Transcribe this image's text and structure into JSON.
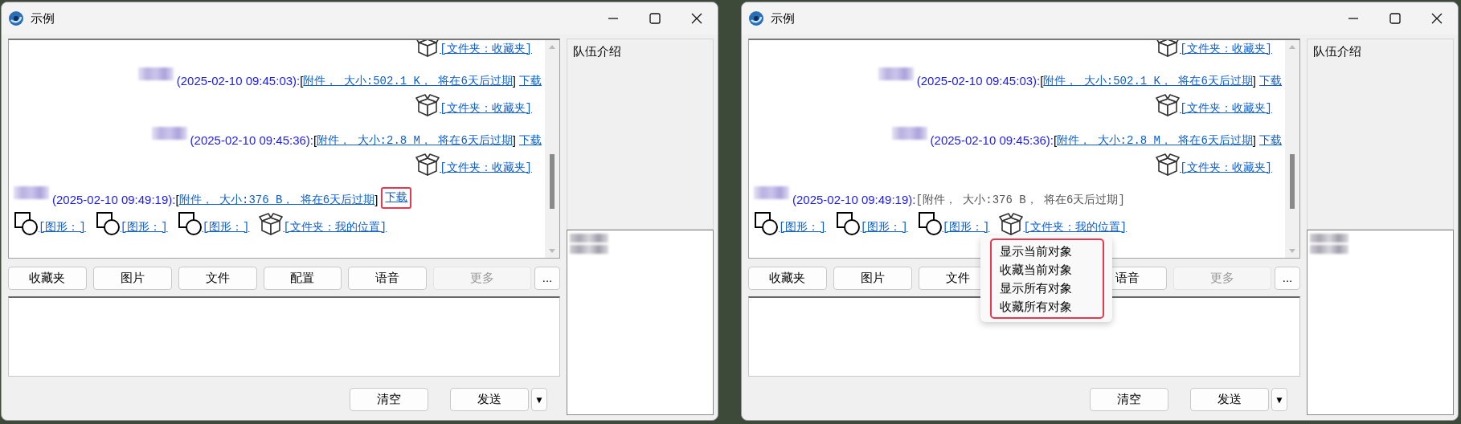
{
  "windows": [
    {
      "title": "示例",
      "chat": {
        "lines": [
          {
            "kind": "received",
            "parts": [
              {
                "kind": "folder",
                "text": "[文件夹：收藏夹]"
              }
            ]
          },
          {
            "kind": "received",
            "parts": [
              {
                "kind": "blur"
              },
              {
                "kind": "time",
                "text": "(2025-02-10 09:45:03):"
              },
              {
                "kind": "plain",
                "text": "["
              },
              {
                "kind": "link",
                "text": "附件， 大小:502.1 K， 将在6天后过期"
              },
              {
                "kind": "plain",
                "text": "]"
              },
              {
                "kind": "link",
                "text": "下载"
              }
            ]
          },
          {
            "kind": "received",
            "parts": [
              {
                "kind": "folder",
                "text": "[文件夹：收藏夹]"
              }
            ]
          },
          {
            "kind": "received",
            "parts": [
              {
                "kind": "blur"
              },
              {
                "kind": "time",
                "text": "(2025-02-10 09:45:36):"
              },
              {
                "kind": "plain",
                "text": "["
              },
              {
                "kind": "link",
                "text": "附件， 大小:2.8 M， 将在6天后过期"
              },
              {
                "kind": "plain",
                "text": "]"
              },
              {
                "kind": "link",
                "text": "下载"
              }
            ]
          },
          {
            "kind": "received",
            "parts": [
              {
                "kind": "folder",
                "text": "[文件夹：收藏夹]"
              }
            ]
          },
          {
            "kind": "sent",
            "parts": [
              {
                "kind": "blur"
              },
              {
                "kind": "time",
                "text": "(2025-02-10 09:49:19):"
              },
              {
                "kind": "plain",
                "text": "["
              },
              {
                "kind": "link",
                "text": "附件， 大小:376 B， 将在6天后过期"
              },
              {
                "kind": "plain",
                "text": "]"
              },
              {
                "kind": "link",
                "text": "下载",
                "highlighted": true
              }
            ]
          },
          {
            "kind": "sent",
            "parts": [
              {
                "kind": "shape",
                "text": "[图形：]"
              },
              {
                "kind": "shape",
                "text": "[图形：]"
              },
              {
                "kind": "shape",
                "text": "[图形：]"
              },
              {
                "kind": "folder",
                "text": "[文件夹：我的位置]"
              }
            ]
          }
        ]
      },
      "toolbar": [
        {
          "label": "收藏夹",
          "disabled": false
        },
        {
          "label": "图片",
          "disabled": false
        },
        {
          "label": "文件",
          "disabled": false
        },
        {
          "label": "配置",
          "disabled": false
        },
        {
          "label": "语音",
          "disabled": false
        },
        {
          "label": "更多",
          "disabled": true
        },
        {
          "label": "...",
          "disabled": false
        }
      ],
      "actions": [
        {
          "label": "清空"
        },
        {
          "label": "发送"
        },
        {
          "label": "▼"
        }
      ],
      "intro": "队伍介绍",
      "members": [
        {
          "kind": "blurred"
        },
        {
          "kind": "blurred"
        }
      ]
    },
    {
      "title": "示例",
      "chat": {
        "lines": [
          {
            "kind": "received",
            "parts": [
              {
                "kind": "folder",
                "text": "[文件夹：收藏夹]"
              }
            ]
          },
          {
            "kind": "received",
            "parts": [
              {
                "kind": "blur"
              },
              {
                "kind": "time",
                "text": "(2025-02-10 09:45:03):"
              },
              {
                "kind": "plain",
                "text": "["
              },
              {
                "kind": "link",
                "text": "附件， 大小:502.1 K， 将在6天后过期"
              },
              {
                "kind": "plain",
                "text": "]"
              },
              {
                "kind": "link",
                "text": "下载"
              }
            ]
          },
          {
            "kind": "received",
            "parts": [
              {
                "kind": "folder",
                "text": "[文件夹：收藏夹]"
              }
            ]
          },
          {
            "kind": "received",
            "parts": [
              {
                "kind": "blur"
              },
              {
                "kind": "time",
                "text": "(2025-02-10 09:45:36):"
              },
              {
                "kind": "plain",
                "text": "["
              },
              {
                "kind": "link",
                "text": "附件， 大小:2.8 M， 将在6天后过期"
              },
              {
                "kind": "plain",
                "text": "]"
              },
              {
                "kind": "link",
                "text": "下载"
              }
            ]
          },
          {
            "kind": "received",
            "parts": [
              {
                "kind": "folder",
                "text": "[文件夹：收藏夹]"
              }
            ]
          },
          {
            "kind": "sent",
            "parts": [
              {
                "kind": "blur"
              },
              {
                "kind": "time",
                "text": "(2025-02-10 09:49:19):"
              },
              {
                "kind": "muted",
                "text": "[附件， 大小:376 B， 将在6天后过期]"
              }
            ]
          },
          {
            "kind": "sent",
            "parts": [
              {
                "kind": "shape",
                "text": "[图形：]"
              },
              {
                "kind": "shape",
                "text": "[图形：]"
              },
              {
                "kind": "shape",
                "text": "[图形：]"
              },
              {
                "kind": "folder",
                "text": "[文件夹：我的位置]"
              }
            ]
          }
        ]
      },
      "toolbar": [
        {
          "label": "收藏夹",
          "disabled": false
        },
        {
          "label": "图片",
          "disabled": false
        },
        {
          "label": "文件",
          "disabled": false
        },
        {
          "label": "语音",
          "disabled": false
        },
        {
          "label": "更多",
          "disabled": true
        },
        {
          "label": "...",
          "disabled": false
        }
      ],
      "actions": [
        {
          "label": "清空"
        },
        {
          "label": "发送"
        },
        {
          "label": "▼"
        }
      ],
      "intro": "队伍介绍",
      "members": [
        {
          "kind": "blurred"
        },
        {
          "kind": "blurred"
        }
      ],
      "context_menu": {
        "highlighted": true,
        "items": [
          {
            "label": "显示当前对象"
          },
          {
            "label": "收藏当前对象"
          },
          {
            "label": "显示所有对象"
          },
          {
            "label": "收藏所有对象"
          }
        ]
      }
    }
  ]
}
